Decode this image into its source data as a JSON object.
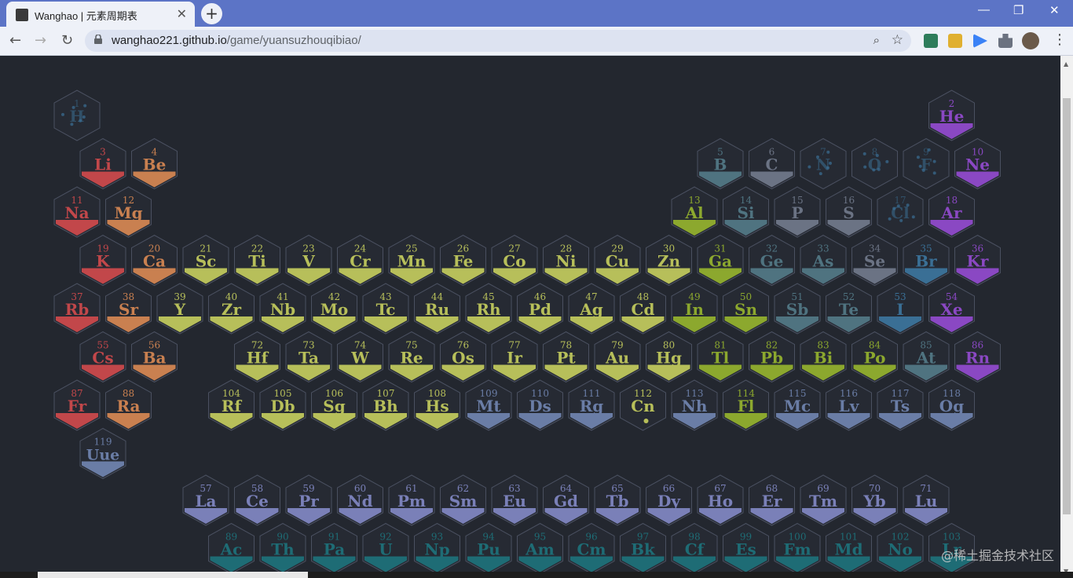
{
  "browser": {
    "tab_title": "Wanghao | 元素周期表",
    "url_host": "wanghao221.github.io",
    "url_path": "/game/yuansuzhouqibiao/"
  },
  "watermark": "@稀土掘金技术社区",
  "colors": {
    "alkali": "#c2474a",
    "alkaline": "#c98050",
    "transition": "#b7bf5a",
    "post_transition": "#8ca82e",
    "metalloid": "#4f7380",
    "nonmetal": "#6b7384",
    "halogen": "#3a6f95",
    "noble": "#8a48c3",
    "unknown": "#6a7da6",
    "lanthanide": "#7a80b8",
    "actinide": "#1e6c75",
    "cell_border": "#4a5060",
    "cell_bg": "#262a33"
  },
  "elements": [
    {
      "n": 1,
      "s": "H",
      "c": "halogen",
      "r": 1,
      "col": 1,
      "dim": true
    },
    {
      "n": 2,
      "s": "He",
      "c": "noble",
      "r": 1,
      "col": 18
    },
    {
      "n": 3,
      "s": "Li",
      "c": "alkali",
      "r": 2,
      "col": 1
    },
    {
      "n": 4,
      "s": "Be",
      "c": "alkaline",
      "r": 2,
      "col": 2
    },
    {
      "n": 5,
      "s": "B",
      "c": "metalloid",
      "r": 2,
      "col": 13
    },
    {
      "n": 6,
      "s": "C",
      "c": "nonmetal",
      "r": 2,
      "col": 14
    },
    {
      "n": 7,
      "s": "N",
      "c": "halogen",
      "r": 2,
      "col": 15,
      "dim": true
    },
    {
      "n": 8,
      "s": "O",
      "c": "halogen",
      "r": 2,
      "col": 16,
      "dim": true
    },
    {
      "n": 9,
      "s": "F",
      "c": "halogen",
      "r": 2,
      "col": 17,
      "dim": true
    },
    {
      "n": 10,
      "s": "Ne",
      "c": "noble",
      "r": 2,
      "col": 18
    },
    {
      "n": 11,
      "s": "Na",
      "c": "alkali",
      "r": 3,
      "col": 1
    },
    {
      "n": 12,
      "s": "Mg",
      "c": "alkaline",
      "r": 3,
      "col": 2
    },
    {
      "n": 13,
      "s": "Al",
      "c": "post_transition",
      "r": 3,
      "col": 13
    },
    {
      "n": 14,
      "s": "Si",
      "c": "metalloid",
      "r": 3,
      "col": 14
    },
    {
      "n": 15,
      "s": "P",
      "c": "nonmetal",
      "r": 3,
      "col": 15
    },
    {
      "n": 16,
      "s": "S",
      "c": "nonmetal",
      "r": 3,
      "col": 16
    },
    {
      "n": 17,
      "s": "Cl",
      "c": "halogen",
      "r": 3,
      "col": 17,
      "dim": true
    },
    {
      "n": 18,
      "s": "Ar",
      "c": "noble",
      "r": 3,
      "col": 18
    },
    {
      "n": 19,
      "s": "K",
      "c": "alkali",
      "r": 4,
      "col": 1
    },
    {
      "n": 20,
      "s": "Ca",
      "c": "alkaline",
      "r": 4,
      "col": 2
    },
    {
      "n": 21,
      "s": "Sc",
      "c": "transition",
      "r": 4,
      "col": 3
    },
    {
      "n": 22,
      "s": "Ti",
      "c": "transition",
      "r": 4,
      "col": 4
    },
    {
      "n": 23,
      "s": "V",
      "c": "transition",
      "r": 4,
      "col": 5
    },
    {
      "n": 24,
      "s": "Cr",
      "c": "transition",
      "r": 4,
      "col": 6
    },
    {
      "n": 25,
      "s": "Mn",
      "c": "transition",
      "r": 4,
      "col": 7
    },
    {
      "n": 26,
      "s": "Fe",
      "c": "transition",
      "r": 4,
      "col": 8
    },
    {
      "n": 27,
      "s": "Co",
      "c": "transition",
      "r": 4,
      "col": 9
    },
    {
      "n": 28,
      "s": "Ni",
      "c": "transition",
      "r": 4,
      "col": 10
    },
    {
      "n": 29,
      "s": "Cu",
      "c": "transition",
      "r": 4,
      "col": 11
    },
    {
      "n": 30,
      "s": "Zn",
      "c": "transition",
      "r": 4,
      "col": 12
    },
    {
      "n": 31,
      "s": "Ga",
      "c": "post_transition",
      "r": 4,
      "col": 13
    },
    {
      "n": 32,
      "s": "Ge",
      "c": "metalloid",
      "r": 4,
      "col": 14
    },
    {
      "n": 33,
      "s": "As",
      "c": "metalloid",
      "r": 4,
      "col": 15
    },
    {
      "n": 34,
      "s": "Se",
      "c": "nonmetal",
      "r": 4,
      "col": 16
    },
    {
      "n": 35,
      "s": "Br",
      "c": "halogen",
      "r": 4,
      "col": 17
    },
    {
      "n": 36,
      "s": "Kr",
      "c": "noble",
      "r": 4,
      "col": 18
    },
    {
      "n": 37,
      "s": "Rb",
      "c": "alkali",
      "r": 5,
      "col": 1
    },
    {
      "n": 38,
      "s": "Sr",
      "c": "alkaline",
      "r": 5,
      "col": 2
    },
    {
      "n": 39,
      "s": "Y",
      "c": "transition",
      "r": 5,
      "col": 3
    },
    {
      "n": 40,
      "s": "Zr",
      "c": "transition",
      "r": 5,
      "col": 4
    },
    {
      "n": 41,
      "s": "Nb",
      "c": "transition",
      "r": 5,
      "col": 5
    },
    {
      "n": 42,
      "s": "Mo",
      "c": "transition",
      "r": 5,
      "col": 6
    },
    {
      "n": 43,
      "s": "Tc",
      "c": "transition",
      "r": 5,
      "col": 7
    },
    {
      "n": 44,
      "s": "Ru",
      "c": "transition",
      "r": 5,
      "col": 8
    },
    {
      "n": 45,
      "s": "Rh",
      "c": "transition",
      "r": 5,
      "col": 9
    },
    {
      "n": 46,
      "s": "Pd",
      "c": "transition",
      "r": 5,
      "col": 10
    },
    {
      "n": 47,
      "s": "Ag",
      "c": "transition",
      "r": 5,
      "col": 11
    },
    {
      "n": 48,
      "s": "Cd",
      "c": "transition",
      "r": 5,
      "col": 12
    },
    {
      "n": 49,
      "s": "In",
      "c": "post_transition",
      "r": 5,
      "col": 13
    },
    {
      "n": 50,
      "s": "Sn",
      "c": "post_transition",
      "r": 5,
      "col": 14
    },
    {
      "n": 51,
      "s": "Sb",
      "c": "metalloid",
      "r": 5,
      "col": 15
    },
    {
      "n": 52,
      "s": "Te",
      "c": "metalloid",
      "r": 5,
      "col": 16
    },
    {
      "n": 53,
      "s": "I",
      "c": "halogen",
      "r": 5,
      "col": 17
    },
    {
      "n": 54,
      "s": "Xe",
      "c": "noble",
      "r": 5,
      "col": 18
    },
    {
      "n": 55,
      "s": "Cs",
      "c": "alkali",
      "r": 6,
      "col": 1
    },
    {
      "n": 56,
      "s": "Ba",
      "c": "alkaline",
      "r": 6,
      "col": 2
    },
    {
      "n": 72,
      "s": "Hf",
      "c": "transition",
      "r": 6,
      "col": 4
    },
    {
      "n": 73,
      "s": "Ta",
      "c": "transition",
      "r": 6,
      "col": 5
    },
    {
      "n": 74,
      "s": "W",
      "c": "transition",
      "r": 6,
      "col": 6
    },
    {
      "n": 75,
      "s": "Re",
      "c": "transition",
      "r": 6,
      "col": 7
    },
    {
      "n": 76,
      "s": "Os",
      "c": "transition",
      "r": 6,
      "col": 8
    },
    {
      "n": 77,
      "s": "Ir",
      "c": "transition",
      "r": 6,
      "col": 9
    },
    {
      "n": 78,
      "s": "Pt",
      "c": "transition",
      "r": 6,
      "col": 10
    },
    {
      "n": 79,
      "s": "Au",
      "c": "transition",
      "r": 6,
      "col": 11
    },
    {
      "n": 80,
      "s": "Hg",
      "c": "transition",
      "r": 6,
      "col": 12
    },
    {
      "n": 81,
      "s": "Tl",
      "c": "post_transition",
      "r": 6,
      "col": 13
    },
    {
      "n": 82,
      "s": "Pb",
      "c": "post_transition",
      "r": 6,
      "col": 14
    },
    {
      "n": 83,
      "s": "Bi",
      "c": "post_transition",
      "r": 6,
      "col": 15
    },
    {
      "n": 84,
      "s": "Po",
      "c": "post_transition",
      "r": 6,
      "col": 16
    },
    {
      "n": 85,
      "s": "At",
      "c": "metalloid",
      "r": 6,
      "col": 17
    },
    {
      "n": 86,
      "s": "Rn",
      "c": "noble",
      "r": 6,
      "col": 18
    },
    {
      "n": 87,
      "s": "Fr",
      "c": "alkali",
      "r": 7,
      "col": 1
    },
    {
      "n": 88,
      "s": "Ra",
      "c": "alkaline",
      "r": 7,
      "col": 2
    },
    {
      "n": 104,
      "s": "Rf",
      "c": "transition",
      "r": 7,
      "col": 4
    },
    {
      "n": 105,
      "s": "Db",
      "c": "transition",
      "r": 7,
      "col": 5
    },
    {
      "n": 106,
      "s": "Sg",
      "c": "transition",
      "r": 7,
      "col": 6
    },
    {
      "n": 107,
      "s": "Bh",
      "c": "transition",
      "r": 7,
      "col": 7
    },
    {
      "n": 108,
      "s": "Hs",
      "c": "transition",
      "r": 7,
      "col": 8
    },
    {
      "n": 109,
      "s": "Mt",
      "c": "unknown",
      "r": 7,
      "col": 9
    },
    {
      "n": 110,
      "s": "Ds",
      "c": "unknown",
      "r": 7,
      "col": 10
    },
    {
      "n": 111,
      "s": "Rg",
      "c": "unknown",
      "r": 7,
      "col": 11
    },
    {
      "n": 112,
      "s": "Cn",
      "c": "transition",
      "r": 7,
      "col": 12,
      "empty": true
    },
    {
      "n": 113,
      "s": "Nh",
      "c": "unknown",
      "r": 7,
      "col": 13
    },
    {
      "n": 114,
      "s": "Fl",
      "c": "post_transition",
      "r": 7,
      "col": 14
    },
    {
      "n": 115,
      "s": "Mc",
      "c": "unknown",
      "r": 7,
      "col": 15
    },
    {
      "n": 116,
      "s": "Lv",
      "c": "unknown",
      "r": 7,
      "col": 16
    },
    {
      "n": 117,
      "s": "Ts",
      "c": "unknown",
      "r": 7,
      "col": 17
    },
    {
      "n": 118,
      "s": "Og",
      "c": "unknown",
      "r": 7,
      "col": 18
    },
    {
      "n": 119,
      "s": "Uue",
      "c": "unknown",
      "r": 8,
      "col": 1
    },
    {
      "n": 57,
      "s": "La",
      "c": "lanthanide",
      "r": 10,
      "col": 3
    },
    {
      "n": 58,
      "s": "Ce",
      "c": "lanthanide",
      "r": 10,
      "col": 4
    },
    {
      "n": 59,
      "s": "Pr",
      "c": "lanthanide",
      "r": 10,
      "col": 5
    },
    {
      "n": 60,
      "s": "Nd",
      "c": "lanthanide",
      "r": 10,
      "col": 6
    },
    {
      "n": 61,
      "s": "Pm",
      "c": "lanthanide",
      "r": 10,
      "col": 7
    },
    {
      "n": 62,
      "s": "Sm",
      "c": "lanthanide",
      "r": 10,
      "col": 8
    },
    {
      "n": 63,
      "s": "Eu",
      "c": "lanthanide",
      "r": 10,
      "col": 9
    },
    {
      "n": 64,
      "s": "Gd",
      "c": "lanthanide",
      "r": 10,
      "col": 10
    },
    {
      "n": 65,
      "s": "Tb",
      "c": "lanthanide",
      "r": 10,
      "col": 11
    },
    {
      "n": 66,
      "s": "Dy",
      "c": "lanthanide",
      "r": 10,
      "col": 12
    },
    {
      "n": 67,
      "s": "Ho",
      "c": "lanthanide",
      "r": 10,
      "col": 13
    },
    {
      "n": 68,
      "s": "Er",
      "c": "lanthanide",
      "r": 10,
      "col": 14
    },
    {
      "n": 69,
      "s": "Tm",
      "c": "lanthanide",
      "r": 10,
      "col": 15
    },
    {
      "n": 70,
      "s": "Yb",
      "c": "lanthanide",
      "r": 10,
      "col": 16
    },
    {
      "n": 71,
      "s": "Lu",
      "c": "lanthanide",
      "r": 10,
      "col": 17
    },
    {
      "n": 89,
      "s": "Ac",
      "c": "actinide",
      "r": 11,
      "col": 4
    },
    {
      "n": 90,
      "s": "Th",
      "c": "actinide",
      "r": 11,
      "col": 5
    },
    {
      "n": 91,
      "s": "Pa",
      "c": "actinide",
      "r": 11,
      "col": 6
    },
    {
      "n": 92,
      "s": "U",
      "c": "actinide",
      "r": 11,
      "col": 7
    },
    {
      "n": 93,
      "s": "Np",
      "c": "actinide",
      "r": 11,
      "col": 8
    },
    {
      "n": 94,
      "s": "Pu",
      "c": "actinide",
      "r": 11,
      "col": 9
    },
    {
      "n": 95,
      "s": "Am",
      "c": "actinide",
      "r": 11,
      "col": 10
    },
    {
      "n": 96,
      "s": "Cm",
      "c": "actinide",
      "r": 11,
      "col": 11
    },
    {
      "n": 97,
      "s": "Bk",
      "c": "actinide",
      "r": 11,
      "col": 12
    },
    {
      "n": 98,
      "s": "Cf",
      "c": "actinide",
      "r": 11,
      "col": 13
    },
    {
      "n": 99,
      "s": "Es",
      "c": "actinide",
      "r": 11,
      "col": 14
    },
    {
      "n": 100,
      "s": "Fm",
      "c": "actinide",
      "r": 11,
      "col": 15
    },
    {
      "n": 101,
      "s": "Md",
      "c": "actinide",
      "r": 11,
      "col": 16
    },
    {
      "n": 102,
      "s": "No",
      "c": "actinide",
      "r": 11,
      "col": 17
    },
    {
      "n": 103,
      "s": "Lr",
      "c": "actinide",
      "r": 11,
      "col": 18
    }
  ]
}
